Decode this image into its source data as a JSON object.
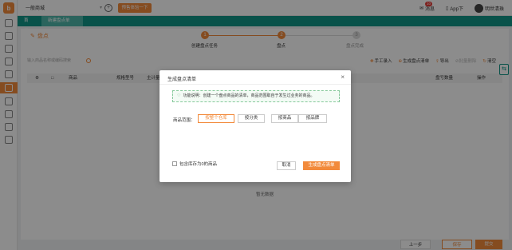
{
  "topbar": {
    "store": "一般商城",
    "try_button": "预售体验一下",
    "notice": "消息",
    "notice_count": "10",
    "app_download": "App下",
    "username": "明世清珠"
  },
  "tabs": [
    {
      "label": "首页"
    },
    {
      "label": "新建盘点单"
    }
  ],
  "page": {
    "title": "盘点",
    "steps": [
      {
        "num": "1",
        "label": "创建盘点任务"
      },
      {
        "num": "2",
        "label": "盘点"
      },
      {
        "num": "3",
        "label": "盘点完成"
      }
    ],
    "search_placeholder": "输入商品名称或编码搜索",
    "actions": [
      "手工录入",
      "生成盘点清单",
      "导出",
      "批量删除",
      "清空"
    ],
    "columns": [
      "商品",
      "规格型号",
      "主计量",
      "盘亏数量",
      "操作"
    ],
    "empty": "暂无数据",
    "prev": "上一步",
    "save": "保存",
    "next": "提交"
  },
  "modal": {
    "title": "生成盘点清单",
    "info": "功能说明：创建一个盘点商品的清单，商品范围取自于发生过业务的商品。",
    "range_label": "商品范围：",
    "range_options": [
      "按整个仓库",
      "按分类",
      "按商品",
      "按品牌"
    ],
    "selected_range": "按整个仓库",
    "include_zero": "包含库存为0的商品",
    "cancel": "取消",
    "generate": "生成盘点清单"
  },
  "colors": {
    "accent": "#f28a3b",
    "teal": "#129688"
  }
}
